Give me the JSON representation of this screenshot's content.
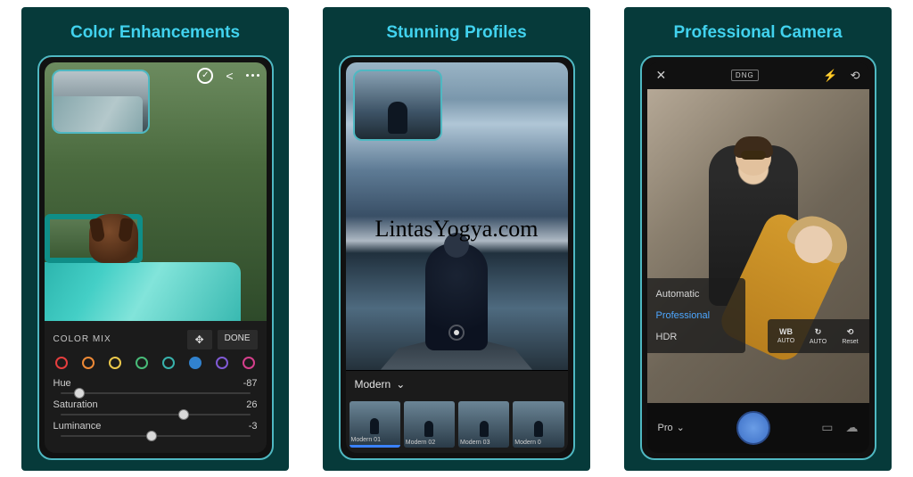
{
  "watermark": "LintasYogya.com",
  "panels": [
    {
      "title": "Color Enhancements",
      "color_mix_label": "COLOR MIX",
      "done_label": "DONE",
      "swatches": [
        "#e53e3e",
        "#ed8936",
        "#ecc94b",
        "#48bb78",
        "#38b2ac",
        "#3182ce",
        "#805ad5",
        "#d53f8c"
      ],
      "sliders": {
        "hue": {
          "label": "Hue",
          "value": "-87",
          "pos": 10
        },
        "saturation": {
          "label": "Saturation",
          "value": "26",
          "pos": 65
        },
        "luminance": {
          "label": "Luminance",
          "value": "-3",
          "pos": 48
        }
      }
    },
    {
      "title": "Stunning Profiles",
      "dropdown_label": "Modern",
      "thumbs": [
        "Modern 01",
        "Modern 02",
        "Modern 03",
        "Modern 0"
      ]
    },
    {
      "title": "Professional Camera",
      "dng_label": "DNG",
      "menu": {
        "auto": "Automatic",
        "pro": "Professional",
        "hdr": "HDR"
      },
      "quick": [
        {
          "top": "WB",
          "bot": "AUTO"
        },
        {
          "top": "↻",
          "bot": "AUTO"
        },
        {
          "top": "⟲",
          "bot": "Reset"
        }
      ],
      "pro_label": "Pro"
    }
  ]
}
